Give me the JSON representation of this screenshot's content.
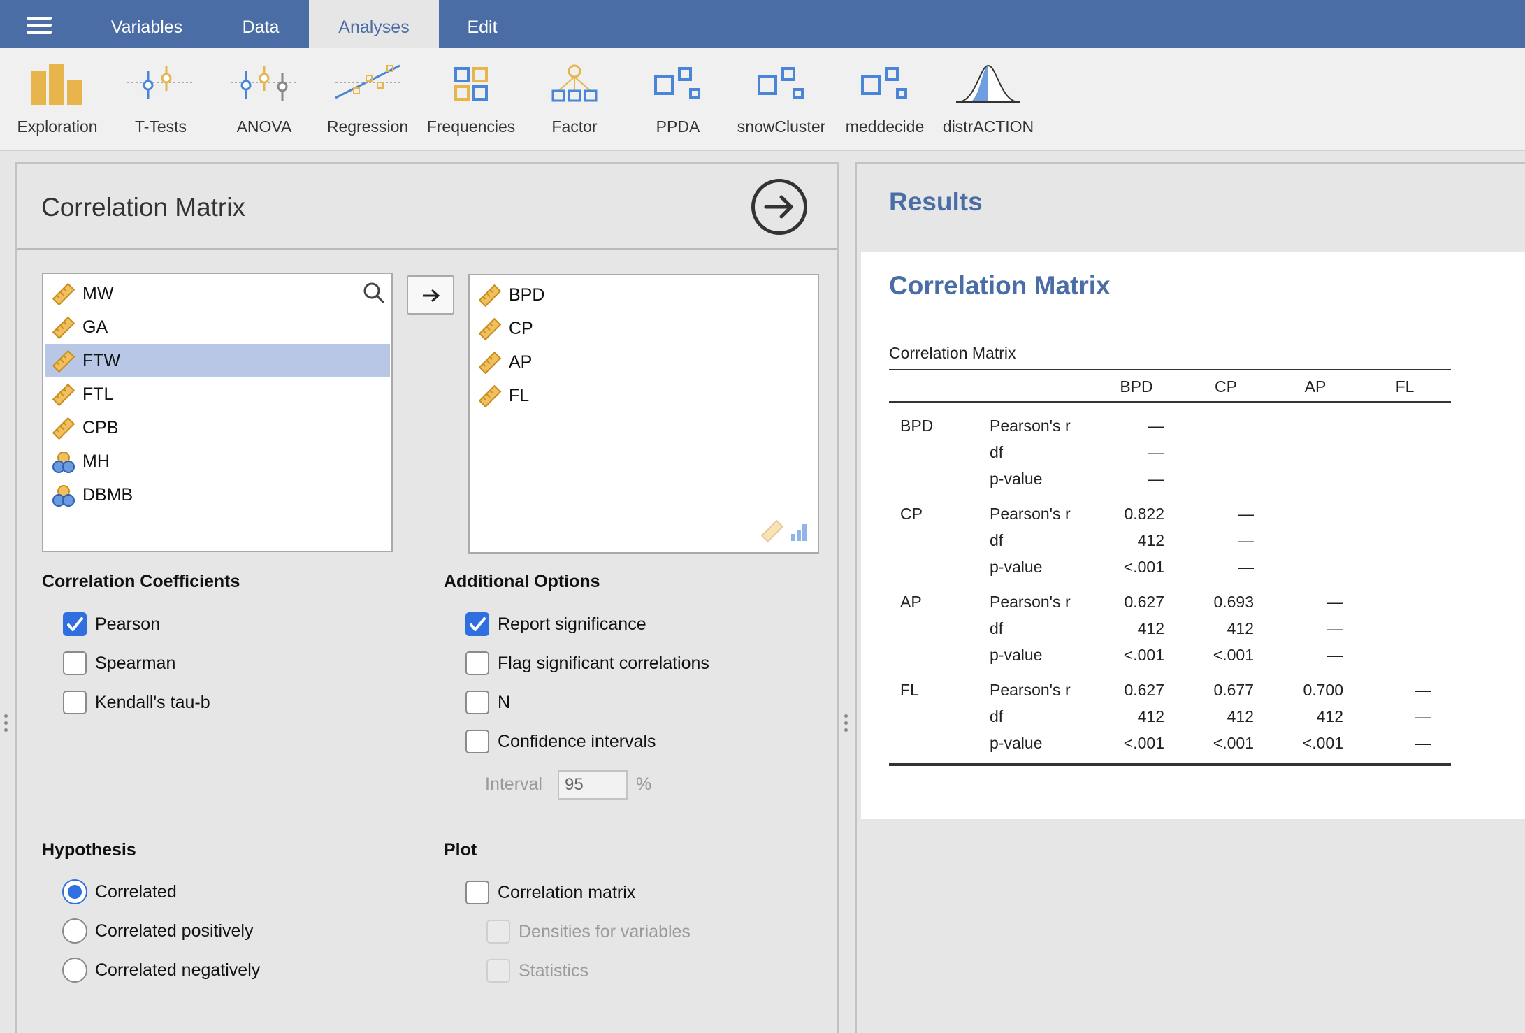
{
  "topbar": {
    "tabs": [
      "Variables",
      "Data",
      "Analyses",
      "Edit"
    ],
    "active_tab": "Analyses"
  },
  "ribbon": {
    "items": [
      "Exploration",
      "T-Tests",
      "ANOVA",
      "Regression",
      "Frequencies",
      "Factor",
      "PPDA",
      "snowCluster",
      "meddecide",
      "distrACTION"
    ]
  },
  "panel": {
    "title": "Correlation Matrix",
    "available_variables": [
      {
        "name": "MW",
        "type": "continuous"
      },
      {
        "name": "GA",
        "type": "continuous"
      },
      {
        "name": "FTW",
        "type": "continuous",
        "selected": true
      },
      {
        "name": "FTL",
        "type": "continuous"
      },
      {
        "name": "CPB",
        "type": "continuous"
      },
      {
        "name": "MH",
        "type": "nominal"
      },
      {
        "name": "DBMB",
        "type": "nominal"
      }
    ],
    "selected_variables": [
      "BPD",
      "CP",
      "AP",
      "FL"
    ],
    "correlation_coefficients": {
      "heading": "Correlation Coefficients",
      "options": [
        {
          "label": "Pearson",
          "checked": true
        },
        {
          "label": "Spearman",
          "checked": false
        },
        {
          "label": "Kendall's tau-b",
          "checked": false
        }
      ]
    },
    "additional_options": {
      "heading": "Additional Options",
      "options": [
        {
          "label": "Report significance",
          "checked": true
        },
        {
          "label": "Flag significant correlations",
          "checked": false
        },
        {
          "label": "N",
          "checked": false
        },
        {
          "label": "Confidence intervals",
          "checked": false
        }
      ],
      "interval_label": "Interval",
      "interval_value": "95",
      "interval_unit": "%"
    },
    "hypothesis": {
      "heading": "Hypothesis",
      "options": [
        {
          "label": "Correlated",
          "selected": true
        },
        {
          "label": "Correlated positively",
          "selected": false
        },
        {
          "label": "Correlated negatively",
          "selected": false
        }
      ]
    },
    "plot": {
      "heading": "Plot",
      "options": [
        {
          "label": "Correlation matrix",
          "checked": false,
          "enabled": true
        },
        {
          "label": "Densities for variables",
          "checked": false,
          "enabled": false
        },
        {
          "label": "Statistics",
          "checked": false,
          "enabled": false
        }
      ]
    }
  },
  "results": {
    "header": "Results",
    "section_title": "Correlation Matrix",
    "table_caption": "Correlation Matrix",
    "columns": [
      "BPD",
      "CP",
      "AP",
      "FL"
    ],
    "stat_labels": [
      "Pearson's r",
      "df",
      "p-value"
    ],
    "rows": [
      {
        "name": "BPD",
        "values": [
          [
            "—",
            "",
            "",
            ""
          ],
          [
            "—",
            "",
            "",
            ""
          ],
          [
            "—",
            "",
            "",
            ""
          ]
        ]
      },
      {
        "name": "CP",
        "values": [
          [
            "0.822",
            "—",
            "",
            ""
          ],
          [
            "412",
            "—",
            "",
            ""
          ],
          [
            "<.001",
            "—",
            "",
            ""
          ]
        ]
      },
      {
        "name": "AP",
        "values": [
          [
            "0.627",
            "0.693",
            "—",
            ""
          ],
          [
            "412",
            "412",
            "—",
            ""
          ],
          [
            "<.001",
            "<.001",
            "—",
            ""
          ]
        ]
      },
      {
        "name": "FL",
        "values": [
          [
            "0.627",
            "0.677",
            "0.700",
            "—"
          ],
          [
            "412",
            "412",
            "412",
            "—"
          ],
          [
            "<.001",
            "<.001",
            "<.001",
            "—"
          ]
        ]
      }
    ]
  },
  "colors": {
    "brand": "#4a6da5",
    "checkbox_accent": "#2f6fe0",
    "analysis_icon": "#e8b54c",
    "selection": "#b8c7e5"
  }
}
